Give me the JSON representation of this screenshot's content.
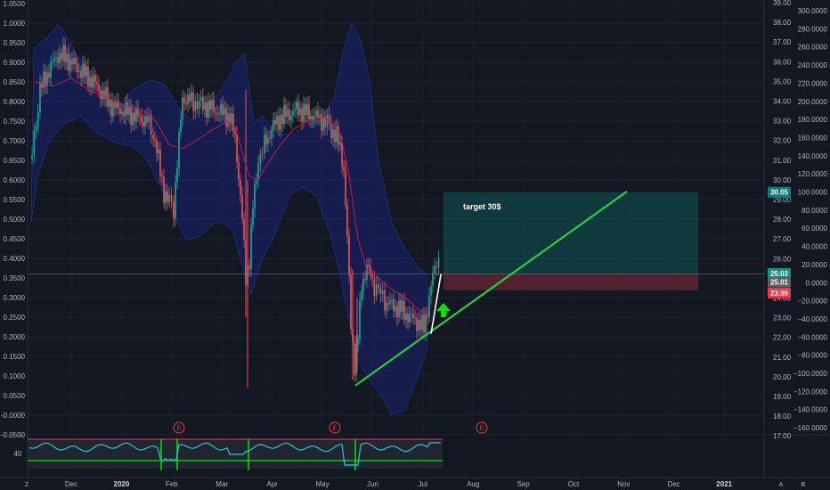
{
  "chart_data": {
    "type": "candlestick",
    "annotation": "target 30$",
    "x_ticks": [
      "Dec",
      "2020",
      "Feb",
      "Mar",
      "Apr",
      "May",
      "Jun",
      "Jul",
      "Aug",
      "Sep",
      "Oct",
      "Nov",
      "Dec",
      "2021"
    ],
    "left_axis": {
      "range": [
        -0.06,
        1.06
      ],
      "ticks": [
        "1.0500",
        "1.0000",
        "0.9500",
        "0.9000",
        "0.8500",
        "0.8000",
        "0.7500",
        "0.7000",
        "0.6500",
        "0.6000",
        "0.5500",
        "0.5000",
        "0.4500",
        "0.4000",
        "0.3500",
        "0.3000",
        "0.2500",
        "0.2000",
        "0.1500",
        "0.1000",
        "0.0500",
        "-0.0000",
        "-0.0500"
      ]
    },
    "price_axis": {
      "range": [
        16.5,
        39.2
      ],
      "ticks": [
        "39.00",
        "38.00",
        "37.00",
        "36.00",
        "35.00",
        "34.00",
        "33.00",
        "32.00",
        "31.00",
        "30.00",
        "29.00",
        "28.00",
        "27.00",
        "26.00",
        "25.00",
        "24.00",
        "23.00",
        "22.00",
        "21.00",
        "20.00",
        "19.00",
        "18.00",
        "17.00"
      ]
    },
    "right_axis": {
      "ticks": [
        "300.0000",
        "280.0000",
        "260.0000",
        "240.0000",
        "220.0000",
        "200.0000",
        "180.0000",
        "160.0000",
        "140.0000",
        "120.0000",
        "100.0000",
        "80.0000",
        "60.0000",
        "40.0000",
        "20.0000",
        "0.0000",
        "−20.0000",
        "−40.0000",
        "−60.0000",
        "−80.0000",
        "−100.0000",
        "−120.0000",
        "−140.0000",
        "−160.0000"
      ]
    },
    "price_badges": [
      {
        "label": "30.05",
        "value": 30.05,
        "color": "#0e7c7b"
      },
      {
        "label": "25.03",
        "value": 25.03,
        "color": "#089981"
      },
      {
        "label": "25.01",
        "value": 25.01,
        "color": "#5d606b"
      },
      {
        "label": "23.99",
        "value": 23.99,
        "color": "#f23645"
      }
    ],
    "position": {
      "entry": 25.0,
      "target": 30.05,
      "stop": 23.99
    },
    "trendline": {
      "from": {
        "date": "May 21",
        "price": 18.1
      },
      "to": {
        "date": "Nov 3",
        "price": 30.1
      }
    },
    "breakout_line": {
      "from": {
        "date": "Jul 6",
        "price": 21.3
      },
      "to": {
        "date": "Jul 12",
        "price": 25.0
      }
    },
    "earnings_markers": [
      "E",
      "E",
      "E"
    ],
    "indicator": {
      "label": "40",
      "series_color": "#26c6da",
      "band_color": "#2962ff"
    },
    "corner_labels": {
      "left": "Z",
      "right_a": "A",
      "right_b": "B"
    },
    "colors": {
      "up": "#26a69a",
      "down": "#ef5350",
      "trend": "#2ecc40",
      "band": "#1a237e",
      "ma": "#c2185b"
    }
  }
}
